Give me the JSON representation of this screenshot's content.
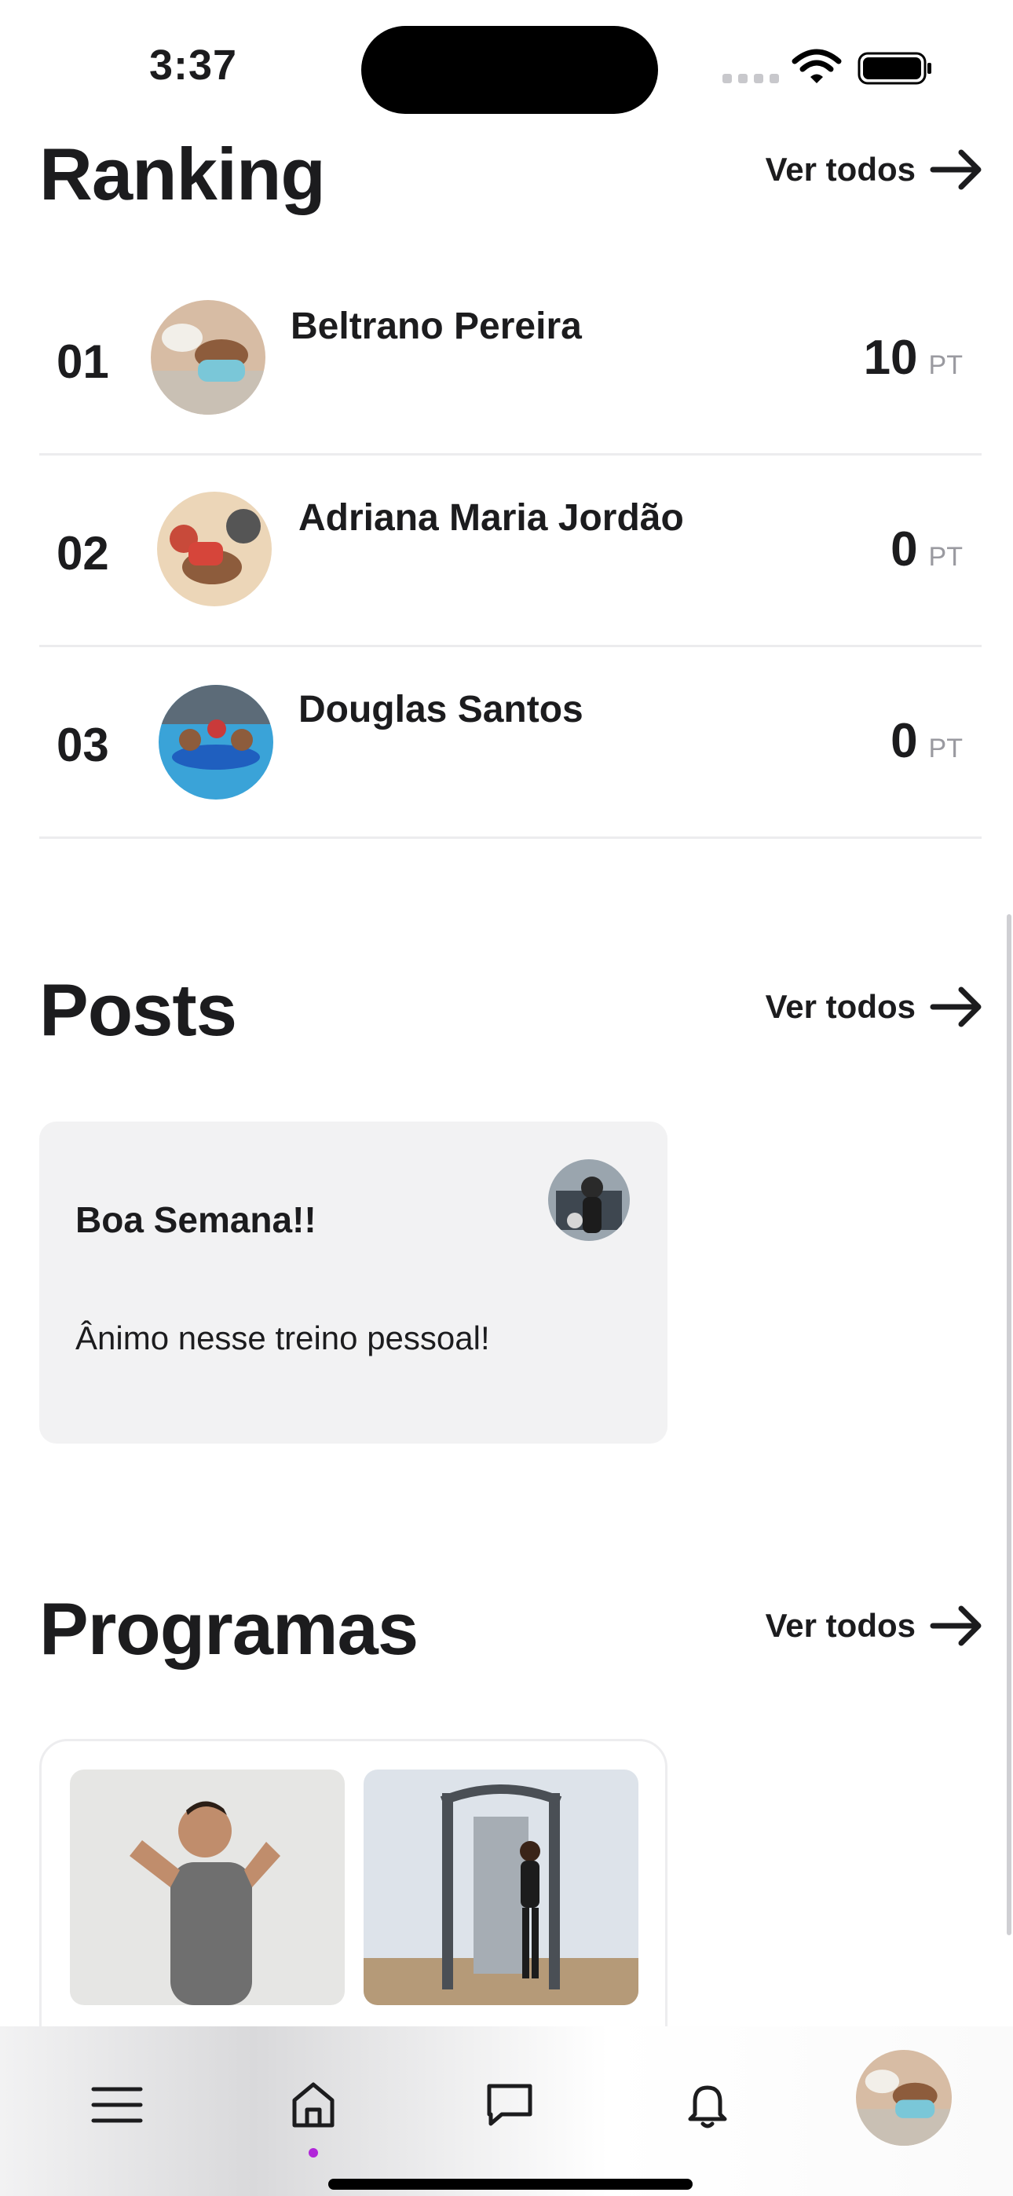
{
  "status_bar": {
    "time": "3:37"
  },
  "ranking": {
    "title": "Ranking",
    "see_all": "Ver todos",
    "rows": [
      {
        "position": "01",
        "name": "Beltrano Pereira",
        "points": "10",
        "unit": "PT"
      },
      {
        "position": "02",
        "name": "Adriana Maria Jordão",
        "points": "0",
        "unit": "PT"
      },
      {
        "position": "03",
        "name": "Douglas Santos",
        "points": "0",
        "unit": "PT"
      }
    ]
  },
  "posts": {
    "title": "Posts",
    "see_all": "Ver todos",
    "items": [
      {
        "title": "Boa Semana!!",
        "body": "Ânimo nesse treino pessoal!"
      }
    ]
  },
  "programs": {
    "title": "Programas",
    "see_all": "Ver todos"
  },
  "tab_bar": {
    "tabs": [
      "menu-icon",
      "home-icon",
      "chat-icon",
      "bell-icon",
      "profile-avatar"
    ],
    "active": "home-icon",
    "accent_color": "#b126d9"
  }
}
